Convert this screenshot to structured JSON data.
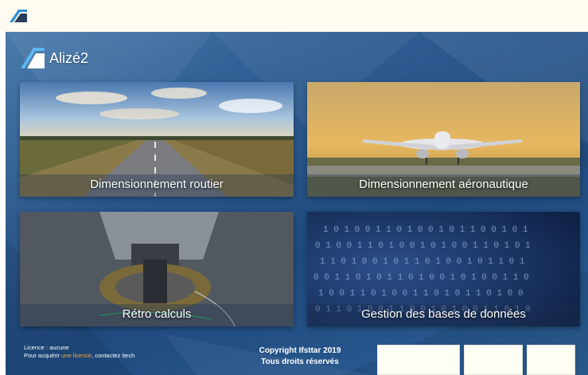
{
  "app": {
    "name": "Alizé2"
  },
  "tiles": [
    {
      "label": "Dimensionnement routier",
      "image": "road-landscape"
    },
    {
      "label": "Dimensionnement aéronautique",
      "image": "airplane-landing"
    },
    {
      "label": "Rétro calculs",
      "image": "deflectometer-wheel"
    },
    {
      "label": "Gestion des bases de données",
      "image": "binary-data"
    }
  ],
  "footer": {
    "licence_line1": "Licence : aucune",
    "licence_line2_pre": "Pour acquérir ",
    "licence_line2_link": "une licence",
    "licence_line2_post": ", contactez itech",
    "copyright_line1": "Copyright Ifsttar 2019",
    "copyright_line2": "Tous droits réservés"
  },
  "colors": {
    "background": "#2a578c",
    "titlebar": "#fffbf0",
    "link": "#ffa640"
  }
}
